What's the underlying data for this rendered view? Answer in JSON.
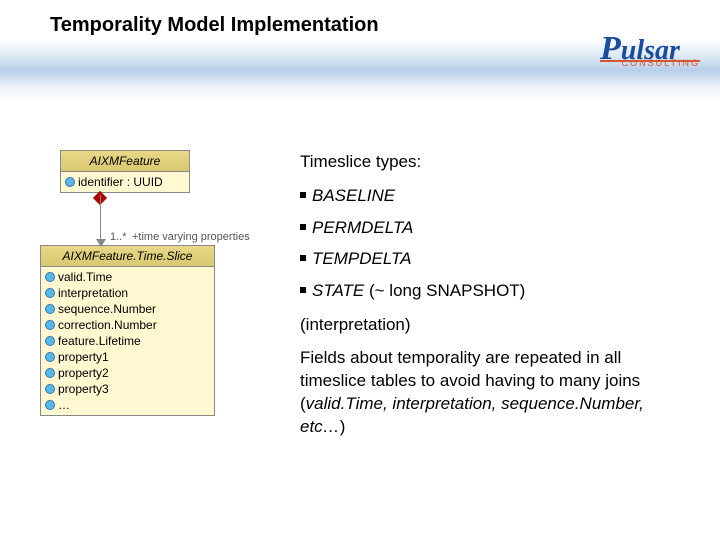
{
  "title": "Temporality Model Implementation",
  "logo": {
    "p": "P",
    "rest": "ulsar",
    "sub": "CONSULTING"
  },
  "uml": {
    "class1_name": "AIXMFeature",
    "class1_attr": "identifier : UUID",
    "mult1": "1..*",
    "mult2": "+time varying properties",
    "class2_name": "AIXMFeature.Time.Slice",
    "class2_attrs": [
      "valid.Time",
      "interpretation",
      "sequence.Number",
      "correction.Number",
      "feature.Lifetime",
      "property1",
      "property2",
      "property3",
      "…"
    ]
  },
  "content": {
    "heading": "Timeslice types:",
    "bullets": [
      "BASELINE",
      "PERMDELTA",
      "TEMPDELTA"
    ],
    "state_bullet": "STATE",
    "state_suffix": "  (~ long SNAPSHOT)",
    "interp": "(interpretation)",
    "para1": "Fields about temporality are repeated in all timeslice tables to avoid having to many joins (",
    "para_ital": "valid.Time, interpretation, sequence.Number, etc…",
    "para2": ")"
  }
}
